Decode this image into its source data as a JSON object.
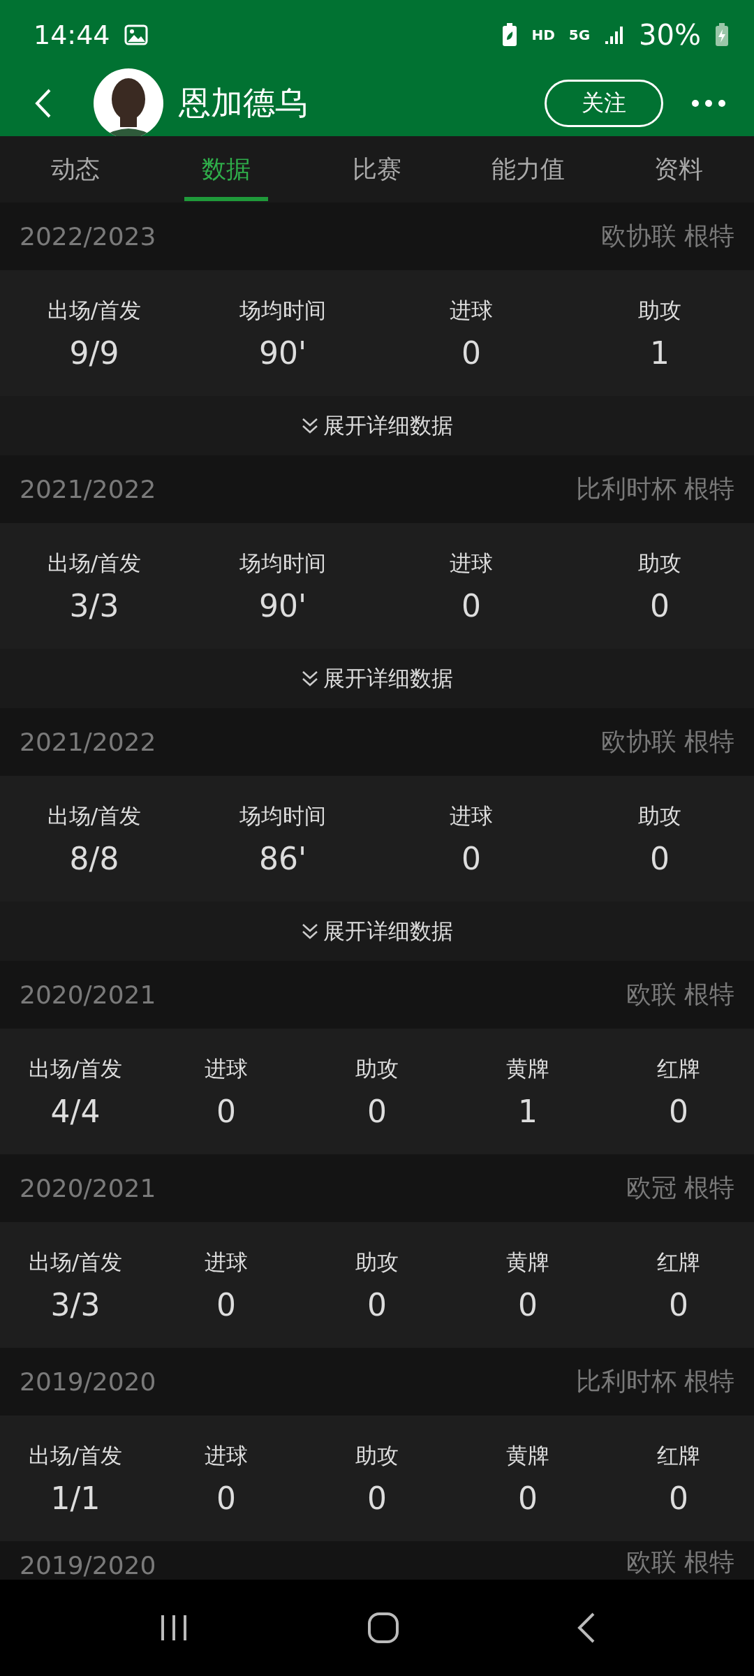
{
  "status_bar": {
    "time": "14:44",
    "network": "HD",
    "generation": "5G",
    "battery": "30%"
  },
  "header": {
    "name": "恩加德乌",
    "follow_button": "关注"
  },
  "tabs": [
    {
      "label": "动态",
      "selected": false
    },
    {
      "label": "数据",
      "selected": true
    },
    {
      "label": "比赛",
      "selected": false
    },
    {
      "label": "能力值",
      "selected": false
    },
    {
      "label": "资料",
      "selected": false
    }
  ],
  "seasons": [
    {
      "season": "2022/2023",
      "competition": "欧协联 根特",
      "stats": [
        {
          "label": "出场/首发",
          "value": "9/9"
        },
        {
          "label": "场均时间",
          "value": "90'"
        },
        {
          "label": "进球",
          "value": "0"
        },
        {
          "label": "助攻",
          "value": "1"
        }
      ],
      "expand": "展开详细数据"
    },
    {
      "season": "2021/2022",
      "competition": "比利时杯 根特",
      "stats": [
        {
          "label": "出场/首发",
          "value": "3/3"
        },
        {
          "label": "场均时间",
          "value": "90'"
        },
        {
          "label": "进球",
          "value": "0"
        },
        {
          "label": "助攻",
          "value": "0"
        }
      ],
      "expand": "展开详细数据"
    },
    {
      "season": "2021/2022",
      "competition": "欧协联 根特",
      "stats": [
        {
          "label": "出场/首发",
          "value": "8/8"
        },
        {
          "label": "场均时间",
          "value": "86'"
        },
        {
          "label": "进球",
          "value": "0"
        },
        {
          "label": "助攻",
          "value": "0"
        }
      ],
      "expand": "展开详细数据"
    },
    {
      "season": "2020/2021",
      "competition": "欧联 根特",
      "stats": [
        {
          "label": "出场/首发",
          "value": "4/4"
        },
        {
          "label": "进球",
          "value": "0"
        },
        {
          "label": "助攻",
          "value": "0"
        },
        {
          "label": "黄牌",
          "value": "1"
        },
        {
          "label": "红牌",
          "value": "0"
        }
      ]
    },
    {
      "season": "2020/2021",
      "competition": "欧冠 根特",
      "stats": [
        {
          "label": "出场/首发",
          "value": "3/3"
        },
        {
          "label": "进球",
          "value": "0"
        },
        {
          "label": "助攻",
          "value": "0"
        },
        {
          "label": "黄牌",
          "value": "0"
        },
        {
          "label": "红牌",
          "value": "0"
        }
      ]
    },
    {
      "season": "2019/2020",
      "competition": "比利时杯 根特",
      "stats": [
        {
          "label": "出场/首发",
          "value": "1/1"
        },
        {
          "label": "进球",
          "value": "0"
        },
        {
          "label": "助攻",
          "value": "0"
        },
        {
          "label": "黄牌",
          "value": "0"
        },
        {
          "label": "红牌",
          "value": "0"
        }
      ]
    },
    {
      "season": "2019/2020",
      "competition": "欧联 根特"
    }
  ]
}
